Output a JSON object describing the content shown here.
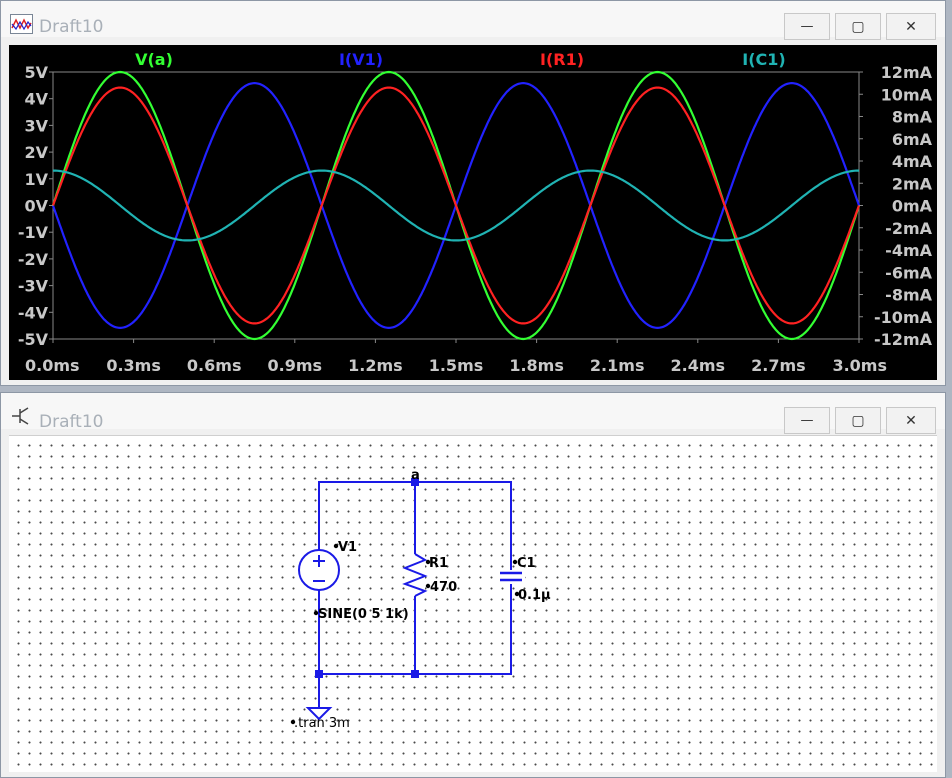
{
  "plot_window": {
    "title": "Draft10"
  },
  "schematic_window": {
    "title": "Draft10"
  },
  "window_controls": {
    "minimize": "—",
    "maximize": "▢",
    "close": "✕"
  },
  "chart_data": {
    "type": "line",
    "series": [
      {
        "name": "V(a)",
        "color": "#33ff33",
        "axis": "left",
        "amplitude": 5,
        "phase_deg": 0,
        "freq_hz": 1000
      },
      {
        "name": "I(V1)",
        "color": "#2222ff",
        "axis": "right",
        "amplitude": 0.011,
        "phase_deg": 180,
        "freq_hz": 1000
      },
      {
        "name": "I(R1)",
        "color": "#ff2222",
        "axis": "right",
        "amplitude": 0.0106,
        "phase_deg": 0,
        "freq_hz": 1000
      },
      {
        "name": "I(C1)",
        "color": "#20b3b3",
        "axis": "right",
        "amplitude": 0.00314,
        "phase_deg": 90,
        "freq_hz": 1000
      }
    ],
    "x_range_ms": [
      0,
      3
    ],
    "x_ticks": [
      "0.0ms",
      "0.3ms",
      "0.6ms",
      "0.9ms",
      "1.2ms",
      "1.5ms",
      "1.8ms",
      "2.1ms",
      "2.4ms",
      "2.7ms",
      "3.0ms"
    ],
    "left_range_v": [
      -5,
      5
    ],
    "left_ticks": [
      "5V",
      "4V",
      "3V",
      "2V",
      "1V",
      "0V",
      "-1V",
      "-2V",
      "-3V",
      "-4V",
      "-5V"
    ],
    "right_range_ma": [
      -12,
      12
    ],
    "right_ticks": [
      "12mA",
      "10mA",
      "8mA",
      "6mA",
      "4mA",
      "2mA",
      "0mA",
      "-2mA",
      "-4mA",
      "-6mA",
      "-8mA",
      "-10mA",
      "-12mA"
    ],
    "grid": false
  },
  "schematic": {
    "node_label": "a",
    "v1_name": "V1",
    "v1_value": "SINE(0 5 1k)",
    "r1_name": "R1",
    "r1_value": "470",
    "c1_name": "C1",
    "c1_value": "0.1µ",
    "directive": ".tran 3m"
  }
}
